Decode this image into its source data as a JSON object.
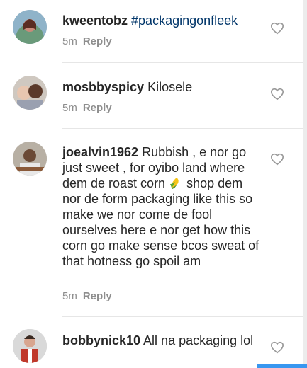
{
  "comments": [
    {
      "username": "kweentobz",
      "text": "#packagingonfleek",
      "time": "5m",
      "reply": "Reply"
    },
    {
      "username": "mosbbyspicy",
      "text": "Kilosele",
      "time": "5m",
      "reply": "Reply"
    },
    {
      "username": "joealvin1962",
      "text_before": "Rubbish , e nor go just sweet , for oyibo land where dem de roast corn",
      "emoji": "corn-emoji",
      "text_after": "shop dem nor de form packaging like this so make we nor come de fool ourselves here e nor get how this corn go make sense bcos sweat of that hotness go spoil am",
      "time": "5m",
      "reply": "Reply"
    },
    {
      "username": "bobbynick10",
      "text": "All na packaging lol"
    }
  ],
  "icons": {
    "like": "heart-icon"
  },
  "colors": {
    "username": "#262626",
    "hashtag": "#003569",
    "meta": "#8e8e8e",
    "accent": "#3897f0"
  }
}
